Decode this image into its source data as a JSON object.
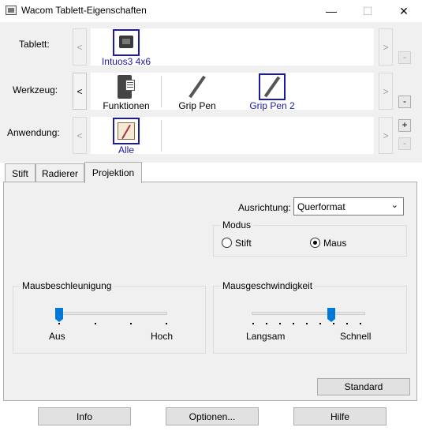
{
  "window": {
    "title": "Wacom Tablett-Eigenschaften",
    "minimize_icon": "minimize-icon",
    "maximize_icon": "maximize-icon",
    "close_icon": "close-icon"
  },
  "rows": {
    "tablet": {
      "label": "Tablett:",
      "items": [
        {
          "label": "Intuos3 4x6",
          "icon": "tablet-icon",
          "selected": true
        }
      ]
    },
    "tool": {
      "label": "Werkzeug:",
      "items": [
        {
          "label": "Funktionen",
          "icon": "functions-icon",
          "selected": false
        },
        {
          "label": "Grip Pen",
          "icon": "pen-icon",
          "selected": false
        },
        {
          "label": "Grip Pen 2",
          "icon": "pen-icon",
          "selected": true
        }
      ]
    },
    "application": {
      "label": "Anwendung:",
      "items": [
        {
          "label": "Alle",
          "icon": "all-applications-icon",
          "selected": true
        }
      ]
    }
  },
  "nav": {
    "left": "<",
    "right": ">",
    "add": "+",
    "remove": "-"
  },
  "tabs": [
    {
      "label": "Stift",
      "active": false
    },
    {
      "label": "Radierer",
      "active": false
    },
    {
      "label": "Projektion",
      "active": true
    }
  ],
  "projection": {
    "orientation_label": "Ausrichtung:",
    "orientation_value": "Querformat",
    "mode_group": "Modus",
    "mode_options": [
      {
        "label": "Stift",
        "checked": false
      },
      {
        "label": "Maus",
        "checked": true
      }
    ],
    "acceleration": {
      "title": "Mausbeschleunigung",
      "min_label": "Aus",
      "max_label": "Hoch",
      "value_fraction": 0.0
    },
    "speed": {
      "title": "Mausgeschwindigkeit",
      "min_label": "Langsam",
      "max_label": "Schnell",
      "value_fraction": 0.73
    },
    "default_button": "Standard"
  },
  "footer": {
    "info": "Info",
    "options": "Optionen...",
    "help": "Hilfe"
  },
  "colors": {
    "selection": "#1a1aa6",
    "slider_thumb": "#0078d7",
    "background": "#f0f0f0"
  }
}
